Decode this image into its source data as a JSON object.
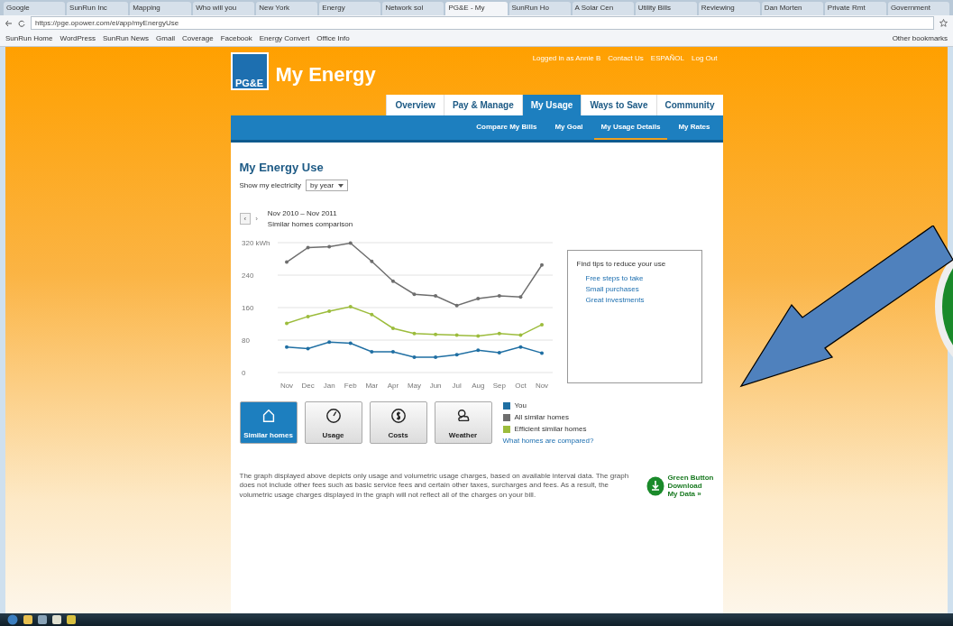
{
  "browser": {
    "tabs": [
      {
        "label": "Google",
        "selected": false
      },
      {
        "label": "SunRun Inc",
        "selected": false
      },
      {
        "label": "Mapping",
        "selected": false
      },
      {
        "label": "Who will you",
        "selected": false
      },
      {
        "label": "New York",
        "selected": false
      },
      {
        "label": "Energy",
        "selected": false
      },
      {
        "label": "Network sol",
        "selected": false
      },
      {
        "label": "PG&E - My",
        "selected": true
      },
      {
        "label": "SunRun Ho",
        "selected": false
      },
      {
        "label": "A Solar Cen",
        "selected": false
      },
      {
        "label": "Utility Bills",
        "selected": false
      },
      {
        "label": "Reviewing",
        "selected": false
      },
      {
        "label": "Dan Morten",
        "selected": false
      },
      {
        "label": "Private Rmt",
        "selected": false
      },
      {
        "label": "Government",
        "selected": false
      }
    ],
    "url": "https://pge.opower.com/ei/app/myEnergyUse",
    "bookmarks": [
      "SunRun Home",
      "WordPress",
      "SunRun News",
      "Gmail",
      "Coverage",
      "Facebook",
      "Energy Convert",
      "Office Info"
    ],
    "other_bookmarks": "Other bookmarks"
  },
  "site": {
    "logo": "PG&E",
    "title": "My Energy",
    "top_links": [
      "Logged in as Annie B",
      "Contact Us",
      "ESPAÑOL",
      "Log Out"
    ],
    "tabs": [
      {
        "label": "Overview",
        "selected": false
      },
      {
        "label": "Pay & Manage",
        "selected": false
      },
      {
        "label": "My Usage",
        "selected": true
      },
      {
        "label": "Ways to Save",
        "selected": false
      },
      {
        "label": "Community",
        "selected": false
      }
    ],
    "subtabs": [
      {
        "label": "Compare My Bills",
        "selected": false
      },
      {
        "label": "My Goal",
        "selected": false
      },
      {
        "label": "My Usage Details",
        "selected": true
      },
      {
        "label": "My Rates",
        "selected": false
      }
    ]
  },
  "content": {
    "heading": "My Energy Use",
    "show_label": "Show my electricity",
    "show_value": "by year",
    "prev": "‹",
    "next": "›",
    "period": "Nov 2010 – Nov 2011",
    "subtitle": "Similar homes comparison",
    "chart_data": {
      "type": "line",
      "grid": true,
      "categories": [
        "Nov",
        "Dec",
        "Jan",
        "Feb",
        "Mar",
        "Apr",
        "May",
        "Jun",
        "Jul",
        "Aug",
        "Sep",
        "Oct",
        "Nov"
      ],
      "series": [
        {
          "name": "You",
          "color": "#1f6fa3",
          "values": [
            63,
            59,
            75,
            72,
            51,
            51,
            38,
            38,
            44,
            55,
            49,
            63,
            48
          ]
        },
        {
          "name": "All similar homes",
          "color": "#6e6e6e",
          "values": [
            272,
            308,
            310,
            319,
            274,
            225,
            193,
            189,
            165,
            182,
            189,
            186,
            265
          ]
        },
        {
          "name": "Efficient similar homes",
          "color": "#9cbc3c",
          "values": [
            121,
            138,
            151,
            162,
            143,
            109,
            96,
            94,
            92,
            90,
            96,
            92,
            118
          ]
        }
      ],
      "ylim": [
        0,
        320
      ],
      "yticks": [
        0,
        {
          "value": 80,
          "label": "80"
        },
        {
          "value": 160,
          "label": "160"
        },
        {
          "value": 240,
          "label": "240"
        },
        {
          "value": 320,
          "label": "320 kWh"
        }
      ]
    },
    "tips": {
      "title": "Find tips to reduce your use",
      "links": [
        "Free steps to take",
        "Small purchases",
        "Great investments"
      ]
    },
    "views": [
      {
        "label": "Similar homes",
        "kind": "home",
        "selected": true
      },
      {
        "label": "Usage",
        "kind": "gauge",
        "selected": false
      },
      {
        "label": "Costs",
        "kind": "dollar",
        "selected": false
      },
      {
        "label": "Weather",
        "kind": "weather",
        "selected": false
      }
    ],
    "compare_link": "What homes are compared?",
    "disclaimer": "The graph displayed above depicts only usage and volumetric usage charges, based on available interval data. The graph does not include other fees such as basic service fees and certain other taxes, surcharges and fees. As a result, the volumetric usage charges displayed in the graph will not reflect all of the charges on your bill.",
    "green_button": {
      "line1": "Green Button",
      "line2": "Download",
      "line3": "My Data »"
    }
  }
}
